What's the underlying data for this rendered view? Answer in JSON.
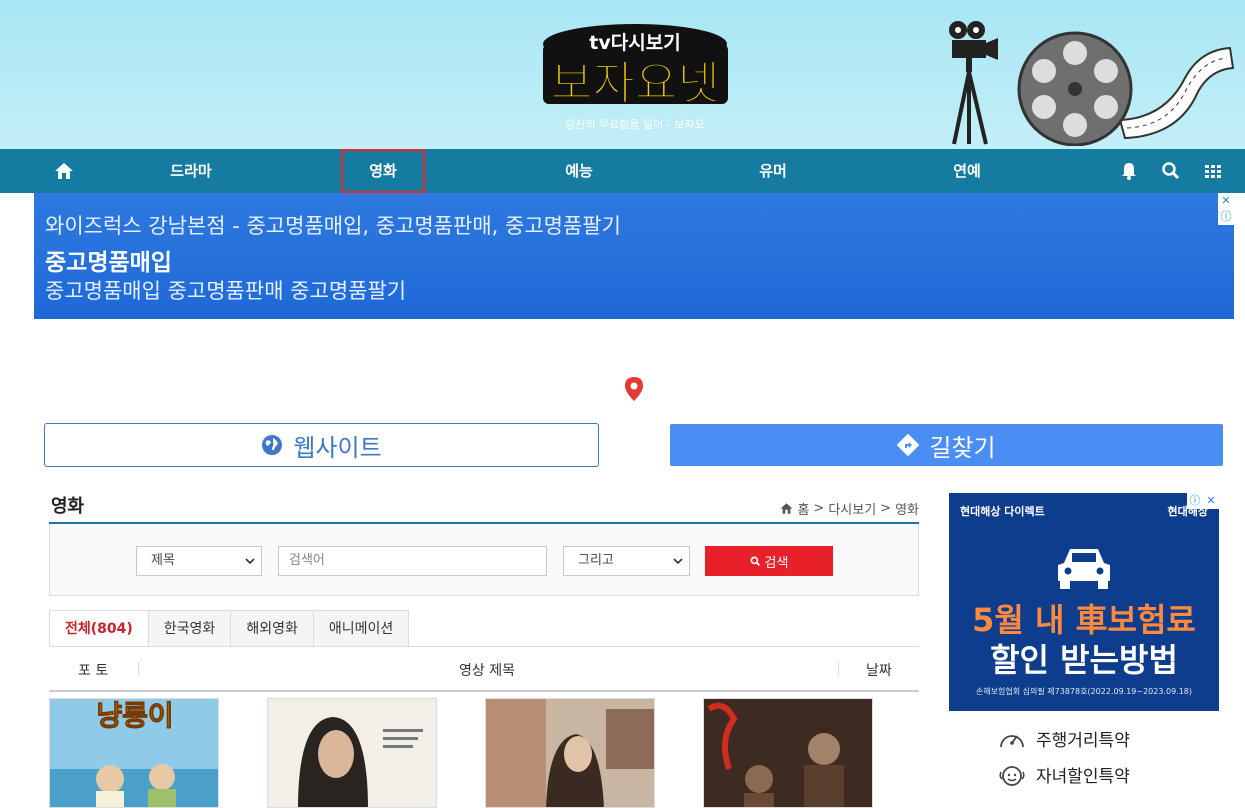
{
  "header": {
    "logo_top": "tv다시보기",
    "logo_main": "보자요넷",
    "tagline": "당신의 무료함을 덜어 - 보자요"
  },
  "nav": {
    "items": [
      {
        "label": "드라마"
      },
      {
        "label": "영화"
      },
      {
        "label": "예능"
      },
      {
        "label": "유머"
      },
      {
        "label": "연예"
      }
    ],
    "active": "영화"
  },
  "ad_banner": {
    "line1": "와이즈럭스 강남본점 - 중고명품매입, 중고명품판매, 중고명품팔기",
    "line2": "중고명품매입",
    "line3": "중고명품매입 중고명품판매 중고명품팔기",
    "close": "✕",
    "info": "ⓘ"
  },
  "buttons": {
    "website": "웹사이트",
    "directions": "길찾기"
  },
  "page": {
    "title": "영화",
    "breadcrumb": [
      "홈",
      "다시보기",
      "영화"
    ],
    "breadcrumb_sep": ">"
  },
  "search": {
    "field_select": "제목",
    "input_placeholder": "검색어",
    "op_select": "그리고",
    "button": "검색"
  },
  "tabs": [
    {
      "label": "전체(804)"
    },
    {
      "label": "한국영화"
    },
    {
      "label": "해외영화"
    },
    {
      "label": "애니메이션"
    }
  ],
  "table_headers": {
    "photo": "포 토",
    "title": "영상 제목",
    "date": "날짜"
  },
  "posters": [
    {
      "title_text": "냥룽이"
    },
    {
      "title_text": ""
    },
    {
      "title_text": ""
    },
    {
      "title_text": ""
    }
  ],
  "side_ad": {
    "brand_left": "현대해상 다이렉트",
    "brand_right": "현대해상",
    "headline1": "5월 내 車보험료",
    "headline2": "할인 받는방법",
    "fine_print": "손해보험협회 심의필 제73878호(2022.09.19~2023.09.18)",
    "close": "✕",
    "info": "ⓘ"
  },
  "side_links": [
    {
      "label": "주행거리특약"
    },
    {
      "label": "자녀할인특약"
    }
  ],
  "colors": {
    "nav_bg": "#167ba0",
    "active_outline": "#e8262a",
    "search_button": "#e8202a",
    "title_underline": "#1c73b4"
  }
}
